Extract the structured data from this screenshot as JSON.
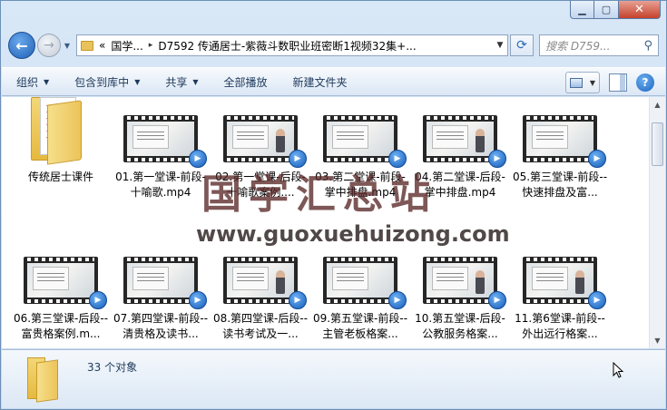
{
  "window": {
    "caption": {
      "minimize": "▁",
      "maximize": "▢",
      "close": "✕"
    }
  },
  "nav": {
    "back_glyph": "←",
    "forward_glyph": "→",
    "history_glyph": "▼",
    "address": {
      "prefix": "«",
      "crumb1": "国学...",
      "crumb2": "D7592 传通居士-紫薇斗数职业班密断1视频32集+...",
      "sep": "▸",
      "drop": "▼"
    },
    "refresh_glyph": "⟳",
    "search_placeholder": "搜索 D759...",
    "search_glyph": "⚲"
  },
  "commands": [
    {
      "label": "组织",
      "arrow": "▼"
    },
    {
      "label": "包含到库中",
      "arrow": "▼"
    },
    {
      "label": "共享",
      "arrow": "▼"
    },
    {
      "label": "全部播放",
      "arrow": ""
    },
    {
      "label": "新建文件夹",
      "arrow": ""
    }
  ],
  "view_arrow": "▼",
  "help_glyph": "?",
  "items": [
    {
      "label": "传统居士课件"
    },
    {
      "label": "01.第一堂课-前段-十喻歌.mp4"
    },
    {
      "label": "02.第一堂课-后段-十喻歌案例...."
    },
    {
      "label": "03.第二堂课-前段-掌中排盘.mp4"
    },
    {
      "label": "04.第二堂课-后段-掌中排盘.mp4"
    },
    {
      "label": "05.第三堂课-前段--快速排盘及富..."
    },
    {
      "label": "06.第三堂课-后段--富贵格案例.m..."
    },
    {
      "label": "07.第四堂课-前段--清贵格及读书..."
    },
    {
      "label": "08.第四堂课-后段--读书考试及一..."
    },
    {
      "label": "09.第五堂课-前段--主管老板格案..."
    },
    {
      "label": "10.第五堂课-后段-公教服务格案..."
    },
    {
      "label": "11.第6堂课-前段--外出远行格案..."
    }
  ],
  "media_glyph": "▶",
  "watermark": {
    "cn": "国学汇总站",
    "url": "www.guoxuehuizong.com"
  },
  "status": {
    "count": "33 个对象"
  },
  "scroll": {
    "up": "▲",
    "down": "▼"
  }
}
